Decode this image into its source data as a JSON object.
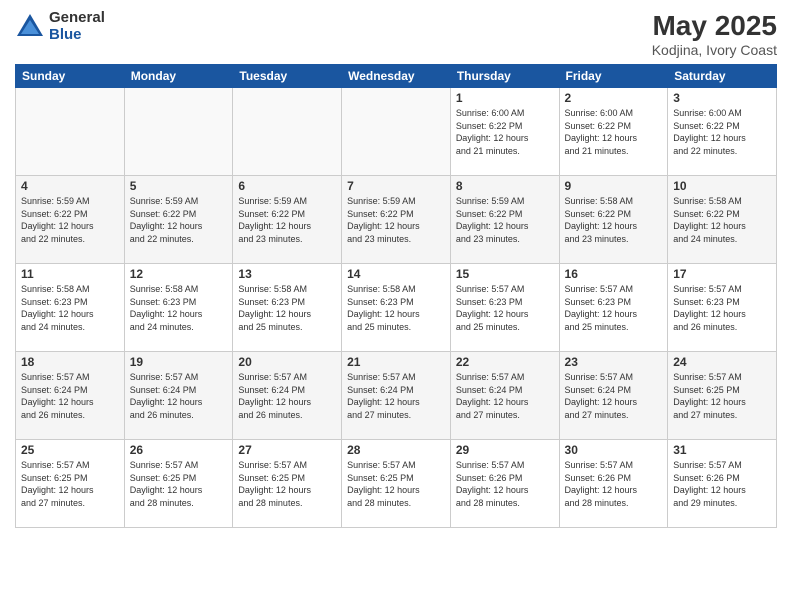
{
  "header": {
    "logo_general": "General",
    "logo_blue": "Blue",
    "title": "May 2025",
    "subtitle": "Kodjina, Ivory Coast"
  },
  "weekdays": [
    "Sunday",
    "Monday",
    "Tuesday",
    "Wednesday",
    "Thursday",
    "Friday",
    "Saturday"
  ],
  "weeks": [
    [
      {
        "day": "",
        "info": ""
      },
      {
        "day": "",
        "info": ""
      },
      {
        "day": "",
        "info": ""
      },
      {
        "day": "",
        "info": ""
      },
      {
        "day": "1",
        "info": "Sunrise: 6:00 AM\nSunset: 6:22 PM\nDaylight: 12 hours\nand 21 minutes."
      },
      {
        "day": "2",
        "info": "Sunrise: 6:00 AM\nSunset: 6:22 PM\nDaylight: 12 hours\nand 21 minutes."
      },
      {
        "day": "3",
        "info": "Sunrise: 6:00 AM\nSunset: 6:22 PM\nDaylight: 12 hours\nand 22 minutes."
      }
    ],
    [
      {
        "day": "4",
        "info": "Sunrise: 5:59 AM\nSunset: 6:22 PM\nDaylight: 12 hours\nand 22 minutes."
      },
      {
        "day": "5",
        "info": "Sunrise: 5:59 AM\nSunset: 6:22 PM\nDaylight: 12 hours\nand 22 minutes."
      },
      {
        "day": "6",
        "info": "Sunrise: 5:59 AM\nSunset: 6:22 PM\nDaylight: 12 hours\nand 23 minutes."
      },
      {
        "day": "7",
        "info": "Sunrise: 5:59 AM\nSunset: 6:22 PM\nDaylight: 12 hours\nand 23 minutes."
      },
      {
        "day": "8",
        "info": "Sunrise: 5:59 AM\nSunset: 6:22 PM\nDaylight: 12 hours\nand 23 minutes."
      },
      {
        "day": "9",
        "info": "Sunrise: 5:58 AM\nSunset: 6:22 PM\nDaylight: 12 hours\nand 23 minutes."
      },
      {
        "day": "10",
        "info": "Sunrise: 5:58 AM\nSunset: 6:22 PM\nDaylight: 12 hours\nand 24 minutes."
      }
    ],
    [
      {
        "day": "11",
        "info": "Sunrise: 5:58 AM\nSunset: 6:23 PM\nDaylight: 12 hours\nand 24 minutes."
      },
      {
        "day": "12",
        "info": "Sunrise: 5:58 AM\nSunset: 6:23 PM\nDaylight: 12 hours\nand 24 minutes."
      },
      {
        "day": "13",
        "info": "Sunrise: 5:58 AM\nSunset: 6:23 PM\nDaylight: 12 hours\nand 25 minutes."
      },
      {
        "day": "14",
        "info": "Sunrise: 5:58 AM\nSunset: 6:23 PM\nDaylight: 12 hours\nand 25 minutes."
      },
      {
        "day": "15",
        "info": "Sunrise: 5:57 AM\nSunset: 6:23 PM\nDaylight: 12 hours\nand 25 minutes."
      },
      {
        "day": "16",
        "info": "Sunrise: 5:57 AM\nSunset: 6:23 PM\nDaylight: 12 hours\nand 25 minutes."
      },
      {
        "day": "17",
        "info": "Sunrise: 5:57 AM\nSunset: 6:23 PM\nDaylight: 12 hours\nand 26 minutes."
      }
    ],
    [
      {
        "day": "18",
        "info": "Sunrise: 5:57 AM\nSunset: 6:24 PM\nDaylight: 12 hours\nand 26 minutes."
      },
      {
        "day": "19",
        "info": "Sunrise: 5:57 AM\nSunset: 6:24 PM\nDaylight: 12 hours\nand 26 minutes."
      },
      {
        "day": "20",
        "info": "Sunrise: 5:57 AM\nSunset: 6:24 PM\nDaylight: 12 hours\nand 26 minutes."
      },
      {
        "day": "21",
        "info": "Sunrise: 5:57 AM\nSunset: 6:24 PM\nDaylight: 12 hours\nand 27 minutes."
      },
      {
        "day": "22",
        "info": "Sunrise: 5:57 AM\nSunset: 6:24 PM\nDaylight: 12 hours\nand 27 minutes."
      },
      {
        "day": "23",
        "info": "Sunrise: 5:57 AM\nSunset: 6:24 PM\nDaylight: 12 hours\nand 27 minutes."
      },
      {
        "day": "24",
        "info": "Sunrise: 5:57 AM\nSunset: 6:25 PM\nDaylight: 12 hours\nand 27 minutes."
      }
    ],
    [
      {
        "day": "25",
        "info": "Sunrise: 5:57 AM\nSunset: 6:25 PM\nDaylight: 12 hours\nand 27 minutes."
      },
      {
        "day": "26",
        "info": "Sunrise: 5:57 AM\nSunset: 6:25 PM\nDaylight: 12 hours\nand 28 minutes."
      },
      {
        "day": "27",
        "info": "Sunrise: 5:57 AM\nSunset: 6:25 PM\nDaylight: 12 hours\nand 28 minutes."
      },
      {
        "day": "28",
        "info": "Sunrise: 5:57 AM\nSunset: 6:25 PM\nDaylight: 12 hours\nand 28 minutes."
      },
      {
        "day": "29",
        "info": "Sunrise: 5:57 AM\nSunset: 6:26 PM\nDaylight: 12 hours\nand 28 minutes."
      },
      {
        "day": "30",
        "info": "Sunrise: 5:57 AM\nSunset: 6:26 PM\nDaylight: 12 hours\nand 28 minutes."
      },
      {
        "day": "31",
        "info": "Sunrise: 5:57 AM\nSunset: 6:26 PM\nDaylight: 12 hours\nand 29 minutes."
      }
    ]
  ]
}
